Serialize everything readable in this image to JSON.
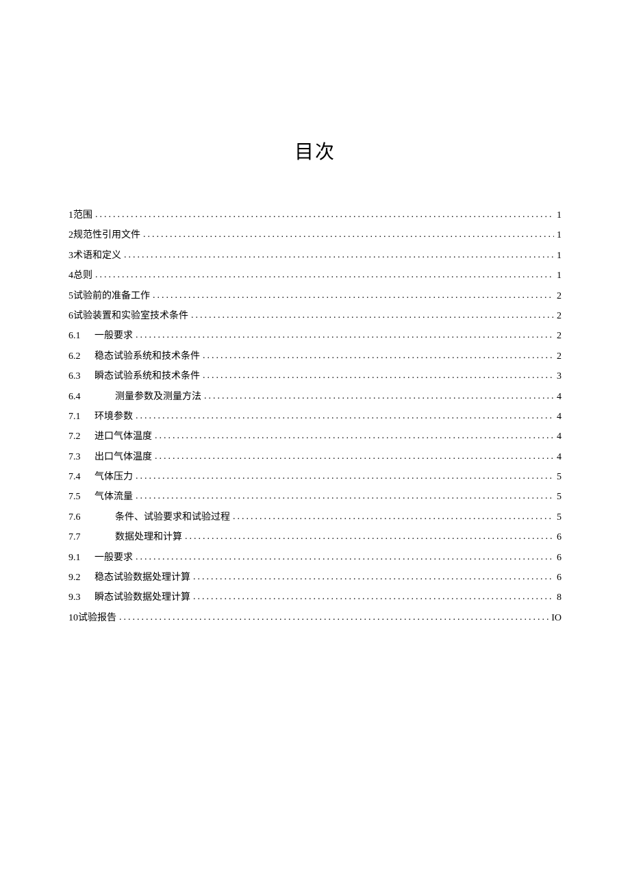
{
  "title": "目次",
  "toc": [
    {
      "class": "indent-0",
      "num": "1",
      "text": "范围",
      "page": "1",
      "prefixGap": " "
    },
    {
      "class": "indent-0",
      "num": "2",
      "text": "规范性引用文件",
      "page": "1",
      "prefixGap": " "
    },
    {
      "class": "indent-0",
      "num": "3",
      "text": "术语和定义",
      "page": "1",
      "prefixGap": " "
    },
    {
      "class": "indent-0",
      "num": "4",
      "text": "总则",
      "page": "1",
      "prefixGap": " "
    },
    {
      "class": "indent-0",
      "num": "5",
      "text": "试验前的准备工作",
      "page": "2",
      "prefixGap": " "
    },
    {
      "class": "indent-0",
      "num": "6",
      "text": "试验装置和实验室技术条件",
      "page": "2",
      "prefixGap": " "
    },
    {
      "class": "indent-1",
      "num": "6.1",
      "text": "一般要求",
      "page": "2",
      "prefixGap": ""
    },
    {
      "class": "indent-1",
      "num": "6.2",
      "text": "稳态试验系统和技术条件",
      "page": "2",
      "prefixGap": ""
    },
    {
      "class": "indent-1",
      "num": "6.3",
      "text": "瞬态试验系统和技术条件",
      "page": "3",
      "prefixGap": ""
    },
    {
      "class": "indent-2",
      "num": "6.4",
      "text": "测量参数及测量方法",
      "page": "4",
      "prefixGap": ""
    },
    {
      "class": "indent-1",
      "num": "7.1",
      "text": "环境参数",
      "page": "4",
      "prefixGap": ""
    },
    {
      "class": "indent-1",
      "num": "7.2",
      "text": "进口气体温度",
      "page": "4",
      "prefixGap": ""
    },
    {
      "class": "indent-1",
      "num": "7.3",
      "text": "出口气体温度",
      "page": "4",
      "prefixGap": ""
    },
    {
      "class": "indent-1",
      "num": "7.4",
      "text": "气体压力",
      "page": "5",
      "prefixGap": ""
    },
    {
      "class": "indent-1",
      "num": "7.5",
      "text": "气体流量",
      "page": "5",
      "prefixGap": ""
    },
    {
      "class": "indent-2",
      "num": "7.6",
      "text": "条件、试验要求和试验过程",
      "page": "5",
      "prefixGap": ""
    },
    {
      "class": "indent-2",
      "num": "7.7",
      "text": "数据处理和计算",
      "page": "6",
      "prefixGap": ""
    },
    {
      "class": "indent-1",
      "num": "9.1",
      "text": "一般要求",
      "page": "6",
      "prefixGap": ""
    },
    {
      "class": "indent-1",
      "num": "9.2",
      "text": "稳态试验数据处理计算",
      "page": "6",
      "prefixGap": ""
    },
    {
      "class": "indent-1",
      "num": "9.3",
      "text": "瞬态试验数据处理计算",
      "page": "8",
      "prefixGap": ""
    },
    {
      "class": "indent-0",
      "num": "10",
      "text": "试验报告",
      "page": "IO",
      "prefixGap": " "
    }
  ]
}
